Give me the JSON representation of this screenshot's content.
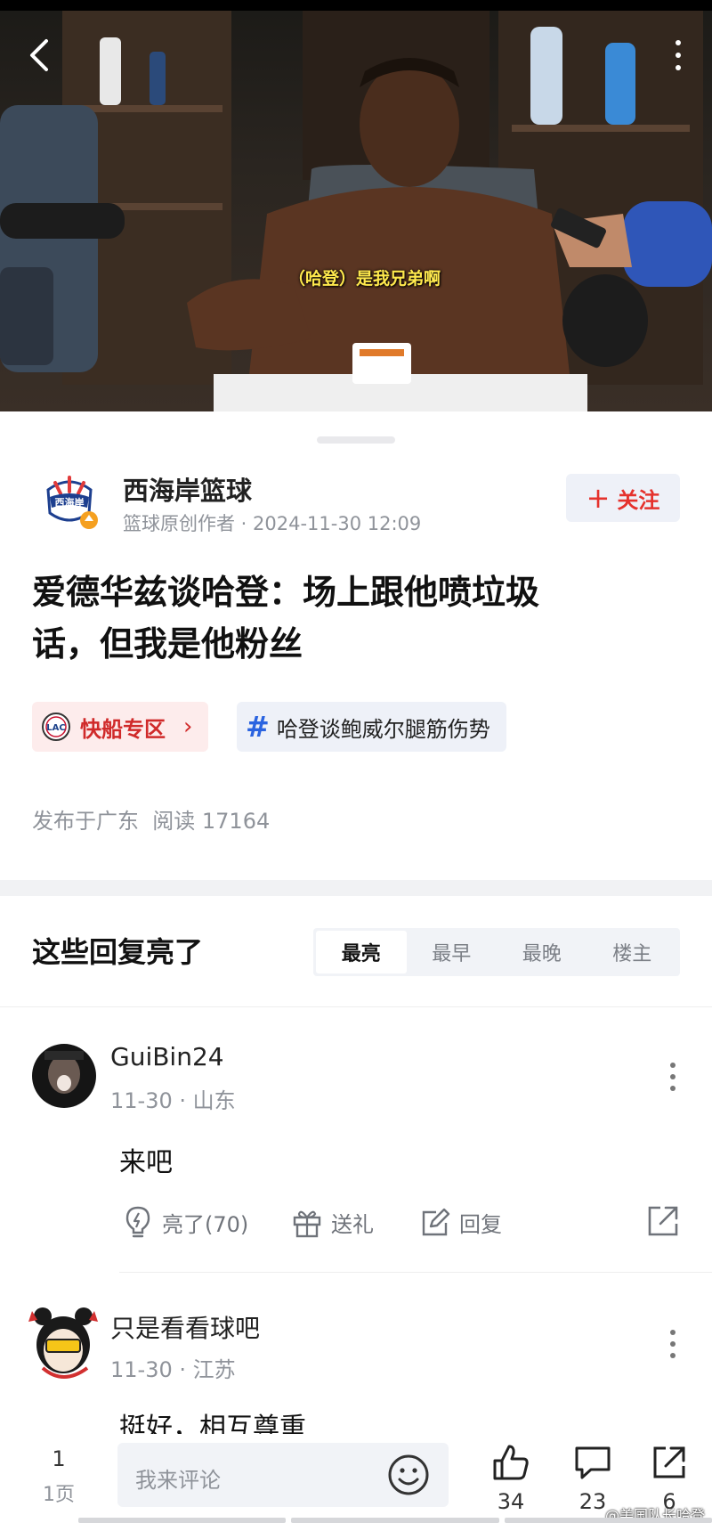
{
  "video": {
    "caption": "（哈登）是我兄弟啊"
  },
  "author": {
    "logo_text": "西海岸",
    "name": "西海岸篮球",
    "meta": "篮球原创作者 · 2024-11-30 12:09",
    "follow_label": "关注"
  },
  "article": {
    "title_line1": "爱德华兹谈哈登：场上跟他喷垃圾",
    "title_line2": "话，但我是他粉丝",
    "tags": [
      {
        "label": "快船专区",
        "icon_text": "LAC"
      },
      {
        "label": "哈登谈鲍威尔腿筋伤势"
      }
    ],
    "meta": "发布于广东  阅读 17164"
  },
  "comments_section": {
    "title": "这些回复亮了",
    "sort_tabs": [
      "最亮",
      "最早",
      "最晚",
      "楼主"
    ],
    "active_tab": "最亮"
  },
  "comments": [
    {
      "user": "GuiBin24",
      "meta": "11-30 · 山东",
      "text": "来吧",
      "actions": {
        "like": "亮了(70)",
        "gift": "送礼",
        "reply": "回复"
      }
    },
    {
      "user": "只是看看球吧",
      "meta": "11-30 · 江苏",
      "text": "挺好，相互尊重"
    }
  ],
  "bottom_bar": {
    "page_num": "1",
    "page_label": "1页",
    "comment_placeholder": "我来评论",
    "like_count": "34",
    "comment_count": "23",
    "share_count": "6",
    "watermark": "@美国队长哈登"
  },
  "colors": {
    "accent_red": "#e5322d",
    "topic_blue": "#2b64e0",
    "muted": "#8f939a"
  },
  "icons": [
    "back-arrow-icon",
    "more-vertical-icon",
    "plus-icon",
    "lac-logo-icon",
    "chevron-right-icon",
    "hash-icon",
    "lightbulb-icon",
    "gift-icon",
    "edit-icon",
    "share-icon",
    "emoji-icon",
    "thumbs-up-icon",
    "comment-icon"
  ]
}
